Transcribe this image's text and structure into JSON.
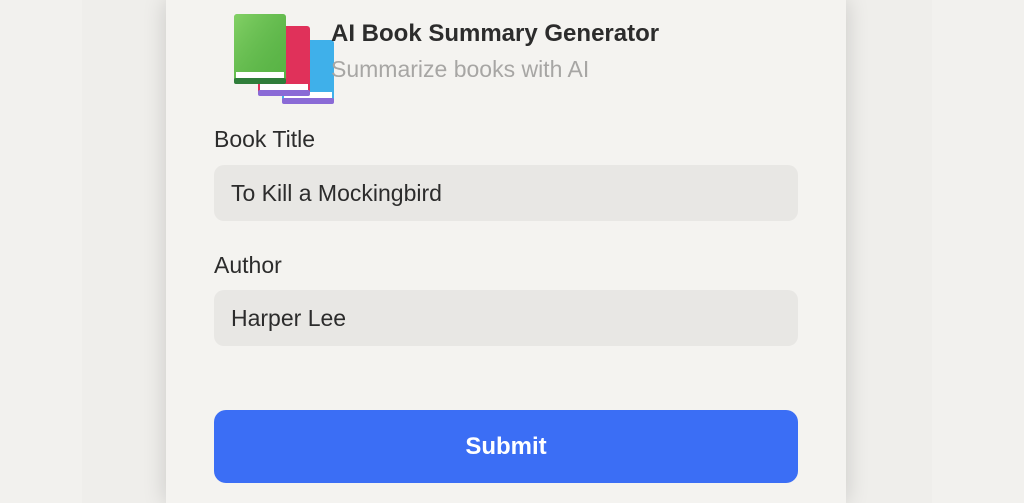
{
  "header": {
    "icon": "books-icon",
    "title": "AI Book Summary Generator",
    "subtitle": "Summarize books with AI"
  },
  "form": {
    "book_title": {
      "label": "Book Title",
      "value": "To Kill a Mockingbird"
    },
    "author": {
      "label": "Author",
      "value": "Harper Lee"
    },
    "submit_label": "Submit"
  },
  "colors": {
    "accent": "#3b6ef5",
    "field_background": "#e8e7e4",
    "card_background": "#f4f3f0",
    "book_green": "#5fba47",
    "book_red": "#e0315a",
    "book_blue": "#3fb0ea"
  }
}
